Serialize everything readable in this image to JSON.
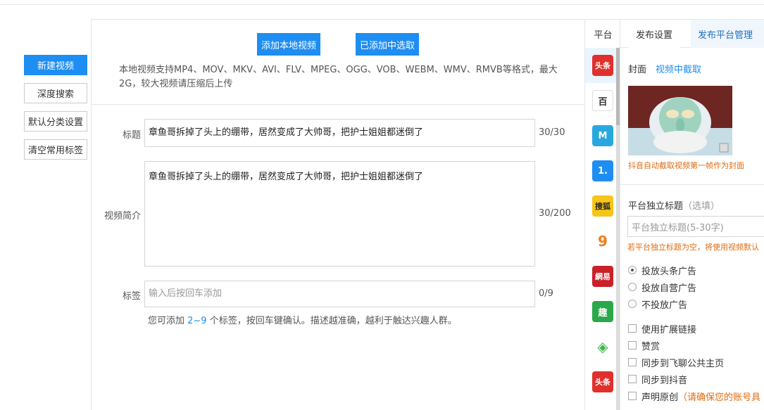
{
  "sidebar": {
    "new_video": "新建视频",
    "deep_search": "深度搜索",
    "default_category": "默认分类设置",
    "clear_tags": "清空常用标签"
  },
  "upload": {
    "add_local": "添加本地视频",
    "pick_added": "已添加中选取",
    "hint": "本地视频支持MP4、MOV、MKV、AVI、FLV、MPEG、OGG、VOB、WEBM、WMV、RMVB等格式，最大2G，较大视频请压缩后上传"
  },
  "form": {
    "title_label": "标题",
    "title_value": "章鱼哥拆掉了头上的绷带，居然变成了大帅哥，把护士姐姐都迷倒了",
    "title_count": "30/30",
    "desc_label": "视频简介",
    "desc_value": "章鱼哥拆掉了头上的绷带，居然变成了大帅哥，把护士姐姐都迷倒了",
    "desc_count": "30/200",
    "tag_label": "标签",
    "tag_placeholder": "输入后按回车添加",
    "tag_count": "0/9",
    "tag_tip_pre": "您可添加 ",
    "tag_tip_num": "2~9",
    "tag_tip_post": " 个标签，按回车键确认。描述越准确，越利于触达兴趣人群。"
  },
  "platforms": {
    "header": "平台",
    "items": [
      {
        "name": "toutiao",
        "glyph": "头条",
        "color": "#e0302c"
      },
      {
        "name": "baijia",
        "glyph": "百",
        "color": "#ffffff"
      },
      {
        "name": "dayu",
        "glyph": "M",
        "color": "#29a8e0"
      },
      {
        "name": "yidian",
        "glyph": "1.",
        "color": "#1e8ef2"
      },
      {
        "name": "sohu",
        "glyph": "搜狐",
        "color": "#f5c518"
      },
      {
        "name": "qie",
        "glyph": "9",
        "color": "#ffffff"
      },
      {
        "name": "wangyi",
        "glyph": "網易",
        "color": "#c9202a"
      },
      {
        "name": "qutoutiao",
        "glyph": "趣",
        "color": "#2aa84a"
      },
      {
        "name": "aiqiyi",
        "glyph": "◈",
        "color": "#ffffff"
      },
      {
        "name": "toutiao2",
        "glyph": "头条",
        "color": "#e0302c"
      }
    ]
  },
  "right_panel": {
    "tab_publish": "发布设置",
    "tab_platform": "发布平台管理",
    "cover_label": "封面",
    "cover_link": "视频中截取",
    "cover_note": "抖音自动截取视频第一帧作为封面",
    "indep_title_label": "平台独立标题",
    "indep_title_optional": "（选填）",
    "indep_title_placeholder": "平台独立标题(5-30字)",
    "indep_title_note": "若平台独立标题为空，将使用视频默认",
    "ad_options": [
      "投放头条广告",
      "投放自营广告",
      "不投放广告"
    ],
    "checks": [
      "使用扩展链接",
      "赞赏",
      "同步到飞聊公共主页",
      "同步到抖音",
      "声明原创"
    ],
    "original_note": "（请确保您的账号具"
  }
}
